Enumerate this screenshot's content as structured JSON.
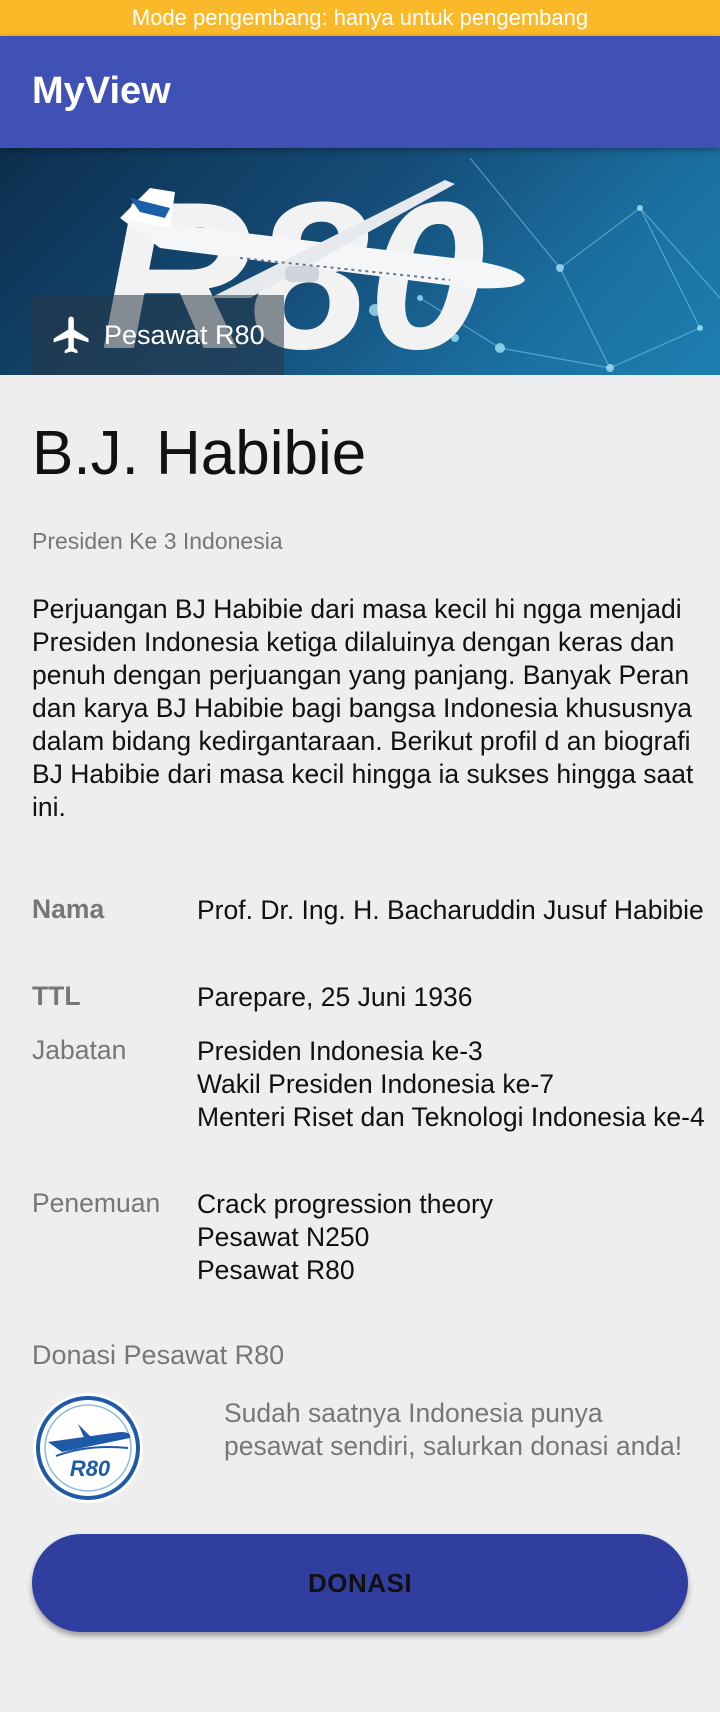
{
  "status_banner": "Mode pengembang: hanya untuk pengembang",
  "app": {
    "title": "MyView"
  },
  "hero": {
    "image_text": "R80",
    "label": "Pesawat R80",
    "icon": "airplane-icon"
  },
  "profile": {
    "name": "B.J. Habibie",
    "subtitle": "Presiden Ke 3 Indonesia",
    "description": "Perjuangan BJ Habibie dari masa kecil hi ngga menjadi Presiden Indonesia ketiga dilaluinya dengan keras dan penuh dengan perjuangan yang panjang. Banyak Peran dan karya BJ Habibie bagi bangsa Indonesia khususnya dalam bidang kedirgantaraan. Berikut profil d an biografi BJ Habibie dari masa kecil hingga ia sukses hingga saat ini."
  },
  "details": [
    {
      "label": "Nama",
      "value": "Prof. Dr. Ing. H. Bacharuddin Jusuf Habibie"
    },
    {
      "label": "TTL",
      "value": "Parepare, 25 Juni 1936"
    },
    {
      "label": "Jabatan",
      "value": "Presiden Indonesia ke-3\n Wakil Presiden Indonesia ke-7\n Menteri Riset dan Teknologi Indonesia ke-4"
    },
    {
      "label": "Penemuan",
      "value": "Crack progression theory\n Pesawat N250\n Pesawat R80"
    }
  ],
  "donation": {
    "title": "Donasi Pesawat R80",
    "logo_text": "R80",
    "text": "Sudah saatnya Indonesia punya pesawat sendiri, salurkan donasi anda!",
    "button_label": "DONASI"
  },
  "colors": {
    "status_bar": "#f9b928",
    "app_bar": "#3f51b5",
    "button": "#303f9f",
    "background": "#eeeeee"
  }
}
